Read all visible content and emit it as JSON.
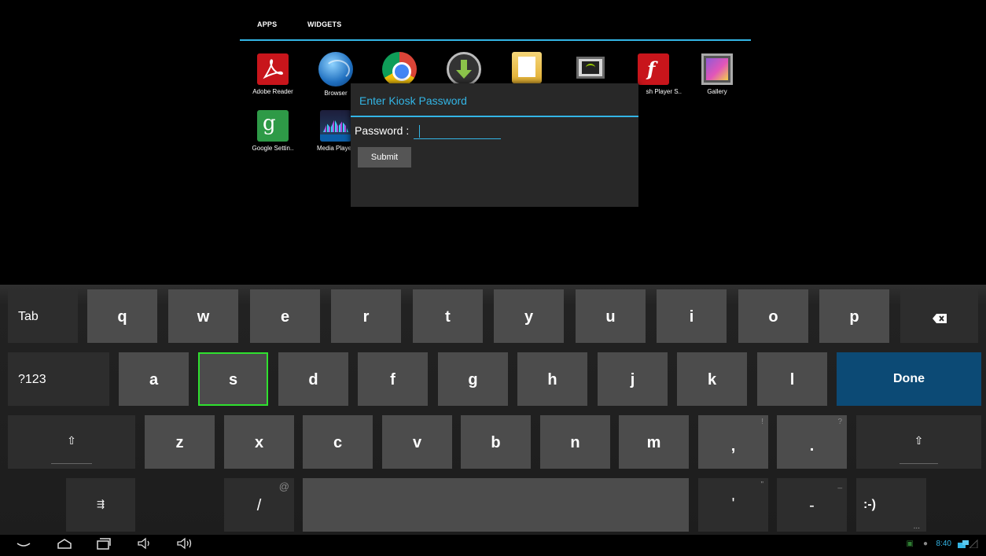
{
  "drawer": {
    "tabs": [
      "APPS",
      "WIDGETS"
    ],
    "apps_row1": [
      {
        "label": "Adobe Reader",
        "icon": "adobe-reader-icon"
      },
      {
        "label": "Browser",
        "icon": "browser-globe-icon"
      },
      {
        "label": "",
        "icon": "chrome-icon"
      },
      {
        "label": "",
        "icon": "downloads-icon"
      },
      {
        "label": "",
        "icon": "file-manager-icon"
      },
      {
        "label": "",
        "icon": "screen-cast-icon"
      },
      {
        "label": "sh Player S..",
        "icon": "flash-player-icon"
      },
      {
        "label": "Gallery",
        "icon": "gallery-icon"
      }
    ],
    "apps_row2": [
      {
        "label": "Google Settin..",
        "icon": "google-settings-icon"
      },
      {
        "label": "Media Playe",
        "icon": "media-player-icon"
      }
    ]
  },
  "dialog": {
    "title": "Enter Kiosk Password",
    "password_label": "Password :",
    "password_value": "",
    "submit_label": "Submit"
  },
  "keyboard": {
    "row1": {
      "left": "Tab",
      "letters": [
        "q",
        "w",
        "e",
        "r",
        "t",
        "y",
        "u",
        "i",
        "o",
        "p"
      ],
      "right_icon": "backspace-icon"
    },
    "row2": {
      "left": "?123",
      "letters": [
        "a",
        "s",
        "d",
        "f",
        "g",
        "h",
        "j",
        "k",
        "l"
      ],
      "right": "Done"
    },
    "row3": {
      "left_icon": "shift-icon",
      "letters": [
        "z",
        "x",
        "c",
        "v",
        "b",
        "n",
        "m"
      ],
      "punct": [
        ",",
        "."
      ],
      "punct_hints": [
        "!",
        "?"
      ],
      "right_icon": "shift-icon"
    },
    "row4": {
      "settings_icon": "keyboard-settings-icon",
      "slash": "/",
      "slash_hint": "@",
      "apostrophe": "'",
      "apostrophe_hint": "\"",
      "dash": "-",
      "dash_hint": "_",
      "smiley": ":-)",
      "smiley_hint": "..."
    },
    "focused_key": "s",
    "accent_color": "#33b5e5",
    "focus_color": "#2fe02f",
    "done_color": "#0c4a75"
  },
  "status": {
    "clock": "8:40"
  }
}
